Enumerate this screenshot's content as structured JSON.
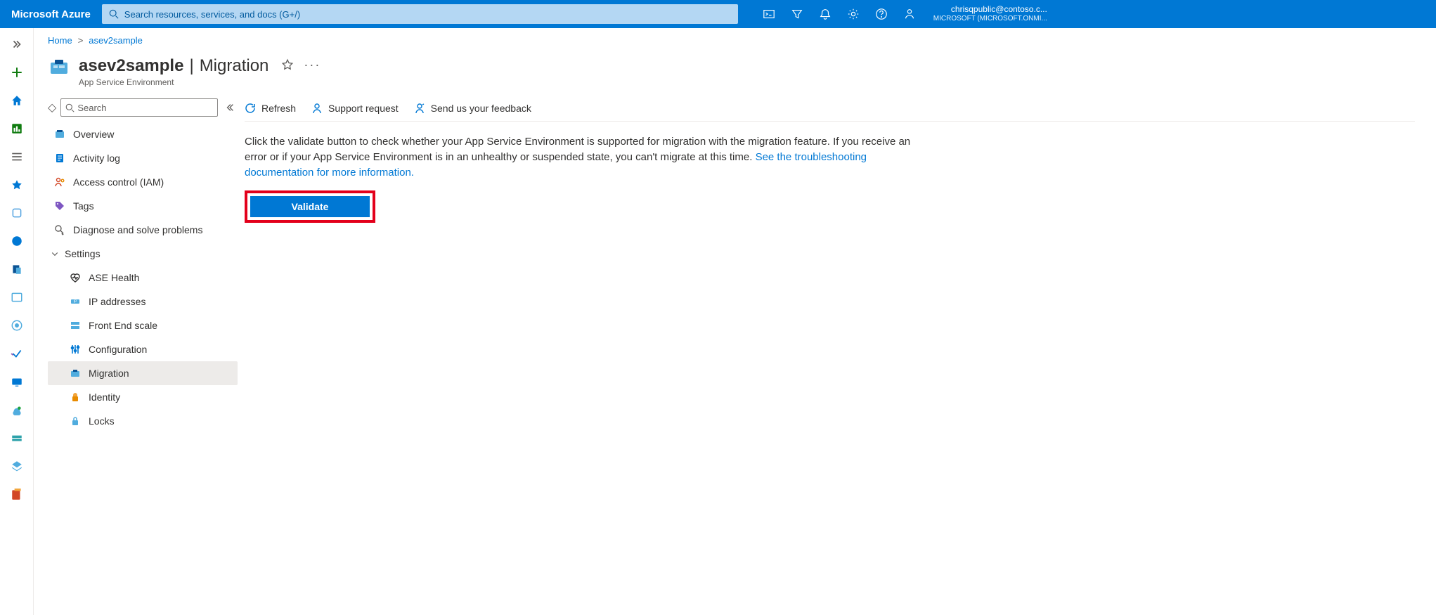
{
  "header": {
    "brand": "Microsoft Azure",
    "search_placeholder": "Search resources, services, and docs (G+/)",
    "account_email": "chrisqpublic@contoso.c...",
    "account_org": "MICROSOFT (MICROSOFT.ONMI..."
  },
  "breadcrumb": {
    "home": "Home",
    "resource": "asev2sample"
  },
  "blade": {
    "resource_name": "asev2sample",
    "page_name": "Migration",
    "subtitle": "App Service Environment"
  },
  "resmenu": {
    "search_placeholder": "Search",
    "items": {
      "overview": "Overview",
      "activity": "Activity log",
      "access": "Access control (IAM)",
      "tags": "Tags",
      "diagnose": "Diagnose and solve problems"
    },
    "group_settings": "Settings",
    "settings_items": {
      "ase_health": "ASE Health",
      "ip": "IP addresses",
      "frontend": "Front End scale",
      "config": "Configuration",
      "migration": "Migration",
      "identity": "Identity",
      "locks": "Locks"
    }
  },
  "cmdbar": {
    "refresh": "Refresh",
    "support": "Support request",
    "feedback": "Send us your feedback"
  },
  "content": {
    "paragraph": "Click the validate button to check whether your App Service Environment is supported for migration with the migration feature. If you receive an error or if your App Service Environment is in an unhealthy or suspended state, you can't migrate at this time. ",
    "link": "See the troubleshooting documentation for more information.",
    "validate_label": "Validate"
  }
}
